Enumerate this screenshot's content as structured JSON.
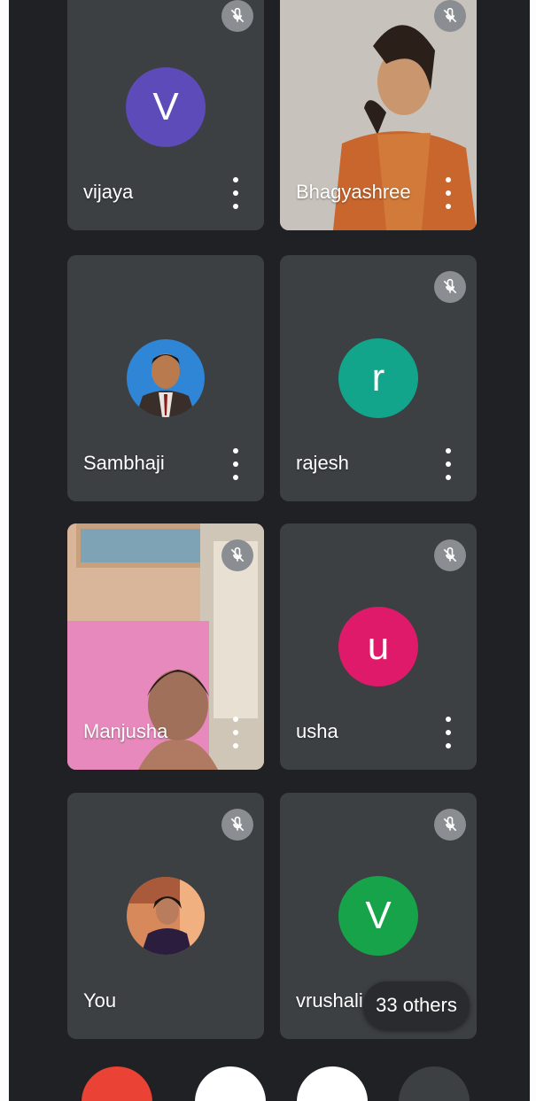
{
  "participants": [
    {
      "name": "vijaya",
      "initial": "V",
      "avatar_color": "#5c4bb8",
      "muted": true,
      "type": "initial"
    },
    {
      "name": "Bhagyashree",
      "muted": true,
      "type": "video"
    },
    {
      "name": "Sambhaji",
      "muted": false,
      "type": "photo"
    },
    {
      "name": "rajesh",
      "initial": "r",
      "avatar_color": "#12a58c",
      "muted": true,
      "type": "initial"
    },
    {
      "name": "Manjusha",
      "muted": true,
      "type": "video"
    },
    {
      "name": "usha",
      "initial": "u",
      "avatar_color": "#e01a6a",
      "muted": true,
      "type": "initial"
    },
    {
      "name": "You",
      "muted": true,
      "type": "photo"
    },
    {
      "name": "vrushali",
      "initial": "V",
      "avatar_color": "#16a34a",
      "muted": true,
      "type": "initial"
    }
  ],
  "others_label": "33 others",
  "controls": [
    {
      "name": "end-call",
      "color": "#ea4335"
    },
    {
      "name": "microphone",
      "color": "#ffffff"
    },
    {
      "name": "camera",
      "color": "#ffffff"
    },
    {
      "name": "more-options",
      "color": "#3c4043"
    }
  ],
  "icons": {
    "mute": "mic-off-icon",
    "more": "more-vert-icon"
  }
}
